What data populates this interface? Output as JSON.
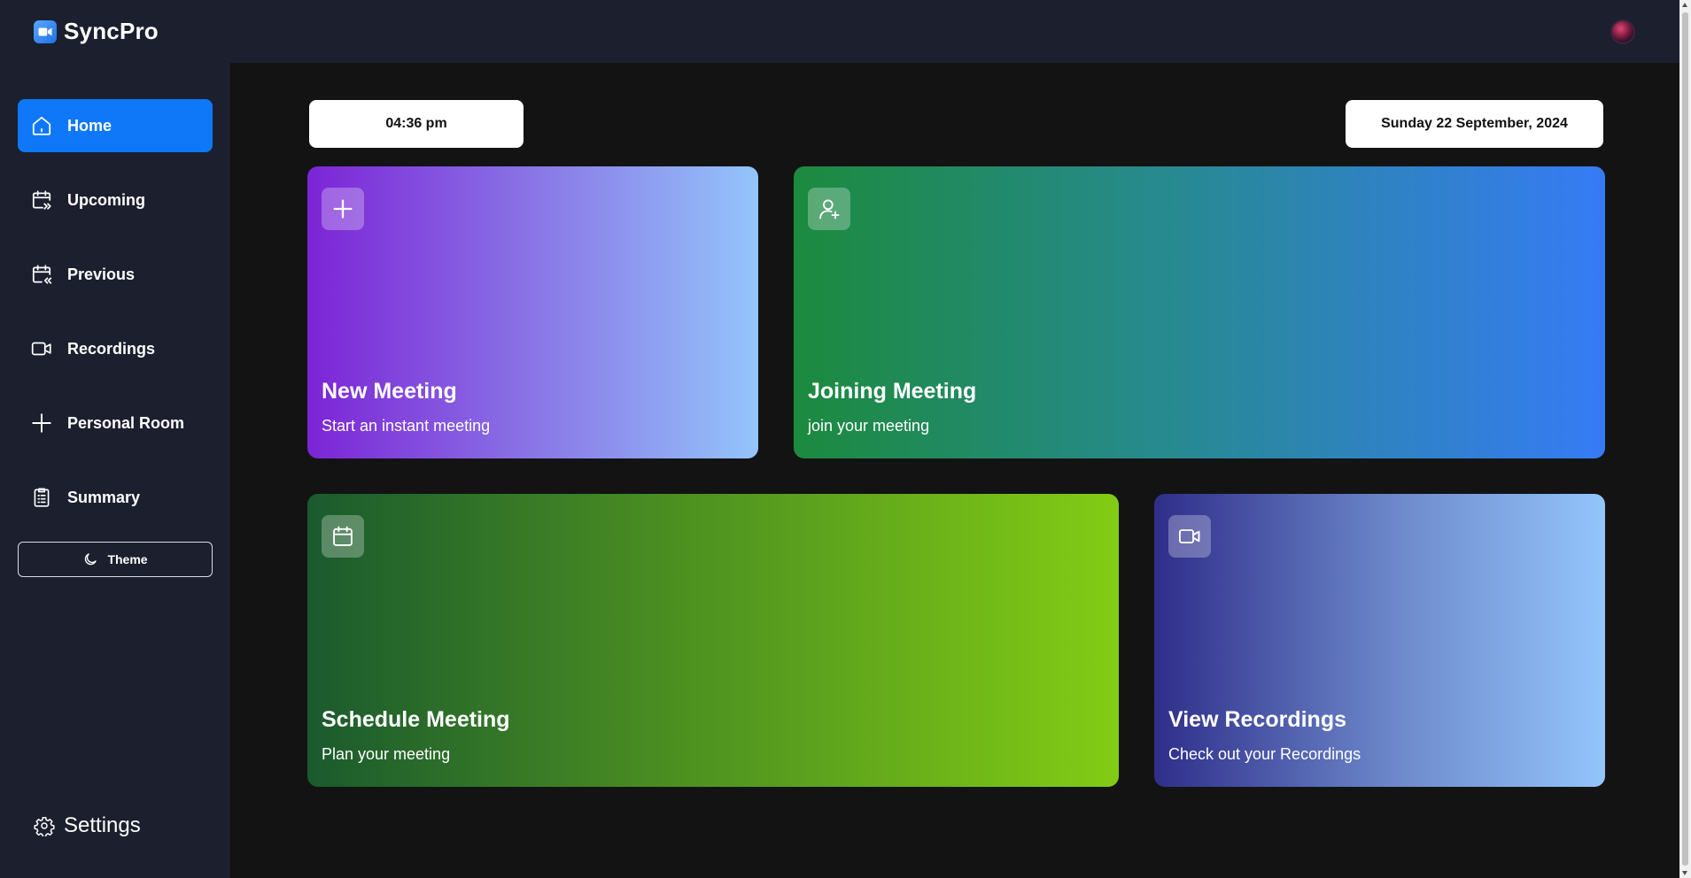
{
  "app": {
    "name": "SyncPro",
    "logo_icon": "video-camera-icon",
    "avatar_icon": "user-avatar"
  },
  "sidebar": {
    "items": [
      {
        "label": "Home",
        "icon": "home-icon",
        "active": true
      },
      {
        "label": "Upcoming",
        "icon": "calendar-forward-icon",
        "active": false
      },
      {
        "label": "Previous",
        "icon": "calendar-back-icon",
        "active": false
      },
      {
        "label": "Recordings",
        "icon": "video-icon",
        "active": false
      },
      {
        "label": "Personal Room",
        "icon": "plus-icon",
        "active": false
      },
      {
        "label": "Summary",
        "icon": "clipboard-list-icon",
        "active": false
      }
    ],
    "theme_label": "Theme",
    "settings_label": "Settings"
  },
  "header": {
    "time": "04:36 pm",
    "date": "Sunday 22 September, 2024"
  },
  "cards": [
    {
      "title": "New Meeting",
      "subtitle": "Start an instant meeting",
      "icon": "plus-icon",
      "colors": [
        "#7c24d6",
        "#93c5fb"
      ]
    },
    {
      "title": "Joining Meeting",
      "subtitle": "join your meeting",
      "icon": "user-plus-icon",
      "colors": [
        "#1c8a3e",
        "#367bf6"
      ]
    },
    {
      "title": "Schedule Meeting",
      "subtitle": "Plan your meeting",
      "icon": "calendar-icon",
      "colors": [
        "#1a5a2e",
        "#83cc14"
      ]
    },
    {
      "title": "View Recordings",
      "subtitle": "Check out your Recordings",
      "icon": "video-icon",
      "colors": [
        "#2f2e8a",
        "#93c5fb"
      ]
    }
  ],
  "colors": {
    "accent": "#0e78f9",
    "sidebar_bg": "#1c1f2e",
    "main_bg": "#131314"
  }
}
